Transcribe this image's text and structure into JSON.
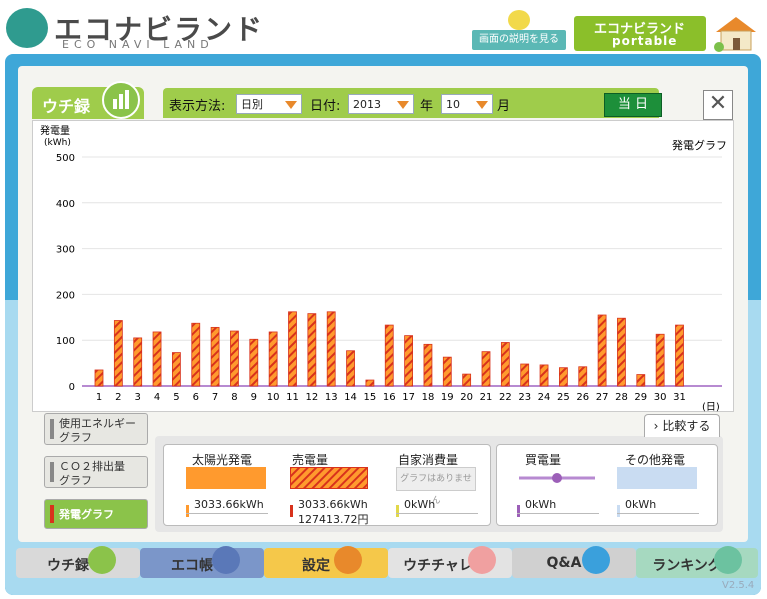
{
  "header": {
    "logo_title": "エコナビランド",
    "logo_subtitle": "ECO NAVI LAND",
    "help_button": "画面の説明を見る",
    "portable_title": "エコナビランド",
    "portable_sub": "portable"
  },
  "tabs": {
    "uchiroku": "ウチ録"
  },
  "toolbar": {
    "display_method_label": "表示方法:",
    "display_method_value": "日別",
    "date_label": "日付:",
    "year_value": "2013",
    "year_unit": "年",
    "month_value": "10",
    "month_unit": "月",
    "today_button": "当 日",
    "close_icon": "✕"
  },
  "chart_data": {
    "type": "bar",
    "title": "発電グラフ",
    "ylabel_line1": "発電量",
    "ylabel_line2": "(kWh)",
    "xlabel": "(日)",
    "ylim": [
      0,
      500
    ],
    "yticks": [
      "0",
      "100",
      "200",
      "300",
      "400",
      "500"
    ],
    "categories": [
      "1",
      "2",
      "3",
      "4",
      "5",
      "6",
      "7",
      "8",
      "9",
      "10",
      "11",
      "12",
      "13",
      "14",
      "15",
      "16",
      "17",
      "18",
      "19",
      "20",
      "21",
      "22",
      "23",
      "24",
      "25",
      "26",
      "27",
      "28",
      "29",
      "30",
      "31"
    ],
    "series": [
      {
        "name": "売電量",
        "values": [
          35,
          143,
          105,
          118,
          73,
          137,
          128,
          120,
          102,
          118,
          162,
          158,
          162,
          77,
          13,
          133,
          110,
          91,
          63,
          26,
          75,
          95,
          48,
          46,
          40,
          42,
          155,
          148,
          25,
          113,
          133
        ]
      }
    ],
    "colors": {
      "bar_fill": "#ff9a2e",
      "bar_stripe": "#d8321c",
      "baseline": "#b78ad1"
    }
  },
  "side_buttons": {
    "energy": "使用エネルギー\nグラフ",
    "co2": "ＣＯ２排出量\nグラフ",
    "power": "発電グラフ"
  },
  "compare": {
    "label": "比較する",
    "chevron": "›"
  },
  "legend": {
    "solar_label": "太陽光発電",
    "solar_value": "3033.66kWh",
    "sell_label": "売電量",
    "sell_value": "3033.66kWh",
    "sell_yen": "127413.72円",
    "self_label": "自家消費量",
    "self_placeholder": "グラフはありません",
    "self_value": "0kWh",
    "buy_label": "買電量",
    "buy_value": "0kWh",
    "other_label": "その他発電",
    "other_value": "0kWh"
  },
  "nav": {
    "uchiroku": "ウチ録",
    "ecocho": "エコ帳",
    "settings": "設定",
    "uchichare": "ウチチャレ",
    "qa": "Q&A",
    "ranking": "ランキング"
  },
  "version": "V2.5.4"
}
